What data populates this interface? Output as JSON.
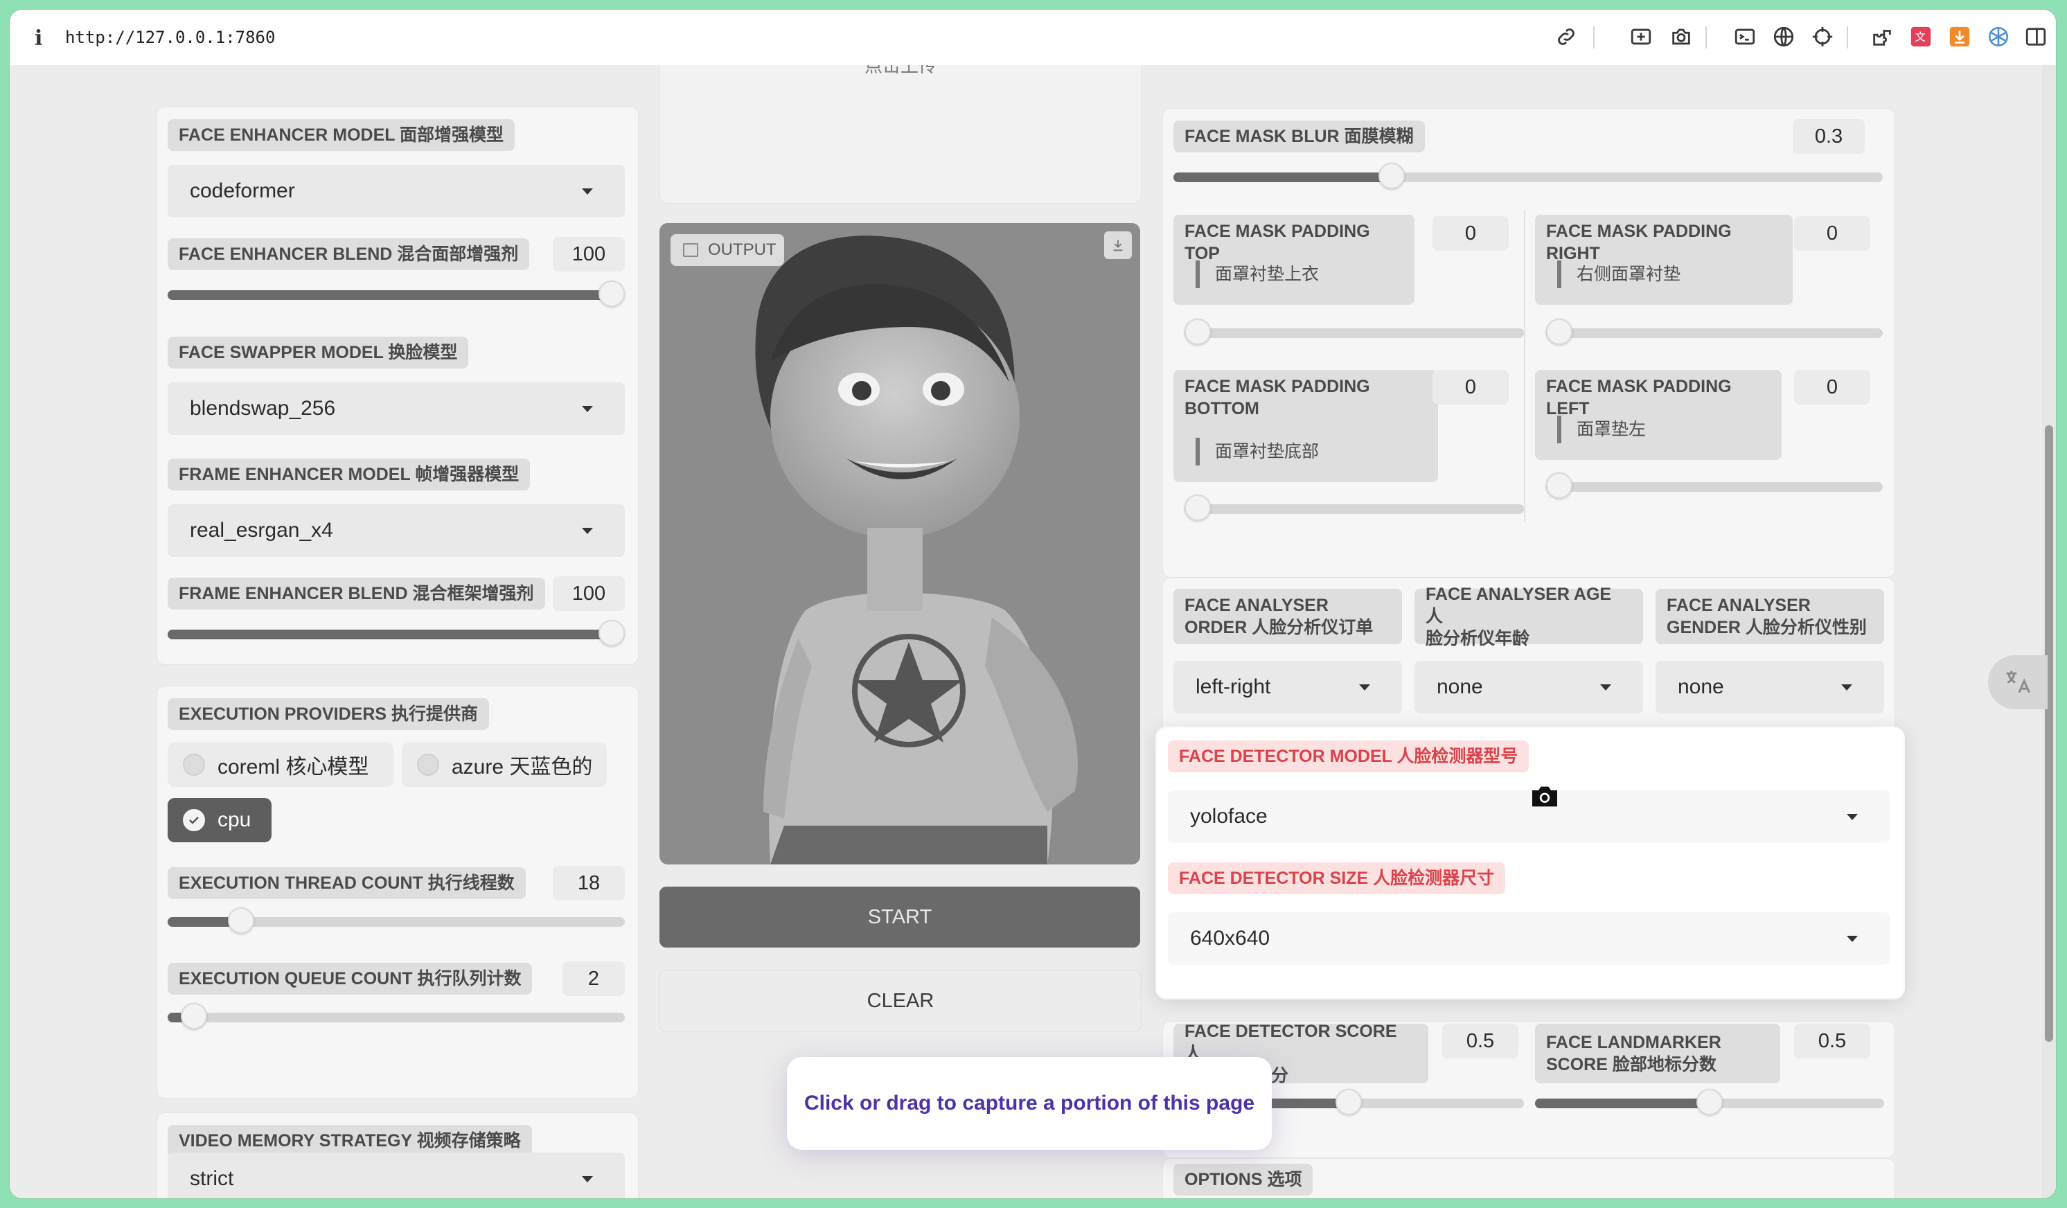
{
  "browser": {
    "info_glyph": "i",
    "url": "http://127.0.0.1:7860"
  },
  "left": {
    "face_enhancer_model": {
      "label": "FACE ENHANCER MODEL 面部增强模型",
      "value": "codeformer"
    },
    "face_enhancer_blend": {
      "label": "FACE ENHANCER BLEND 混合面部增强剂",
      "value": "100",
      "level": 1.0
    },
    "face_swapper_model": {
      "label": "FACE SWAPPER MODEL 换脸模型",
      "value": "blendswap_256"
    },
    "frame_enhancer_model": {
      "label": "FRAME ENHANCER MODEL 帧增强器模型",
      "value": "real_esrgan_x4"
    },
    "frame_enhancer_blend": {
      "label": "FRAME ENHANCER BLEND 混合框架增强剂",
      "value": "100",
      "level": 1.0
    },
    "execution_providers": {
      "label": "EXECUTION PROVIDERS 执行提供商",
      "options": [
        "coreml 核心模型",
        "azure 天蓝色的",
        "cpu"
      ],
      "selected": "cpu"
    },
    "execution_thread_count": {
      "label": "EXECUTION THREAD COUNT 执行线程数",
      "value": "18",
      "level": 0.14
    },
    "execution_queue_count": {
      "label": "EXECUTION QUEUE COUNT 执行队列计数",
      "value": "2",
      "level": 0.03
    },
    "video_memory_strategy": {
      "label": "VIDEO MEMORY STRATEGY 视频存储策略",
      "value": "strict"
    }
  },
  "middle": {
    "upload_hint": "点击上传",
    "output_label": "OUTPUT",
    "start_label": "START",
    "clear_label": "CLEAR"
  },
  "right": {
    "face_mask_blur": {
      "label": "FACE MASK BLUR 面膜模糊",
      "value": "0.3",
      "level": 0.3
    },
    "padding_top": {
      "label": "FACE MASK PADDING TOP",
      "sub": "面罩衬垫上衣",
      "value": "0",
      "level": 0
    },
    "padding_right": {
      "label": "FACE MASK PADDING RIGHT",
      "sub": "右侧面罩衬垫",
      "value": "0",
      "level": 0
    },
    "padding_bottom": {
      "label_line1": "FACE MASK PADDING",
      "label_line2": "BOTTOM",
      "sub": "面罩衬垫底部",
      "value": "0",
      "level": 0
    },
    "padding_left": {
      "label": "FACE MASK PADDING LEFT",
      "sub": "面罩垫左",
      "value": "0",
      "level": 0
    },
    "face_analyser_order": {
      "label_line1": "FACE ANALYSER",
      "label_line2": "ORDER 人脸分析仪订单",
      "value": "left-right"
    },
    "face_analyser_age": {
      "label_line1": "FACE ANALYSER AGE 人",
      "label_line2": "脸分析仪年龄",
      "value": "none"
    },
    "face_analyser_gender": {
      "label_line1": "FACE ANALYSER",
      "label_line2": "GENDER 人脸分析仪性别",
      "value": "none"
    },
    "face_detector_model": {
      "label": "FACE DETECTOR MODEL 人脸检测器型号",
      "value": "yoloface"
    },
    "face_detector_size": {
      "label": "FACE DETECTOR SIZE 人脸检测器尺寸",
      "value": "640x640"
    },
    "face_detector_score": {
      "label_line1": "FACE DETECTOR SCORE 人",
      "label_line2": "脸检测器得分",
      "value": "0.5",
      "level": 0.5
    },
    "face_landmarker_score": {
      "label_line1": "FACE LANDMARKER",
      "label_line2": "SCORE 脸部地标分数",
      "value": "0.5",
      "level": 0.5
    },
    "options": {
      "label": "OPTIONS 选项"
    }
  },
  "overlay": {
    "capture_hint": "Click or drag to capture a portion of this page"
  },
  "icons": [
    "link-icon",
    "screenshot-icon",
    "camera-icon",
    "terminal-icon",
    "globe-icon",
    "crosshair-icon",
    "extension-icon",
    "translate-icon",
    "download-icon",
    "network-icon",
    "sidebar-icon"
  ]
}
